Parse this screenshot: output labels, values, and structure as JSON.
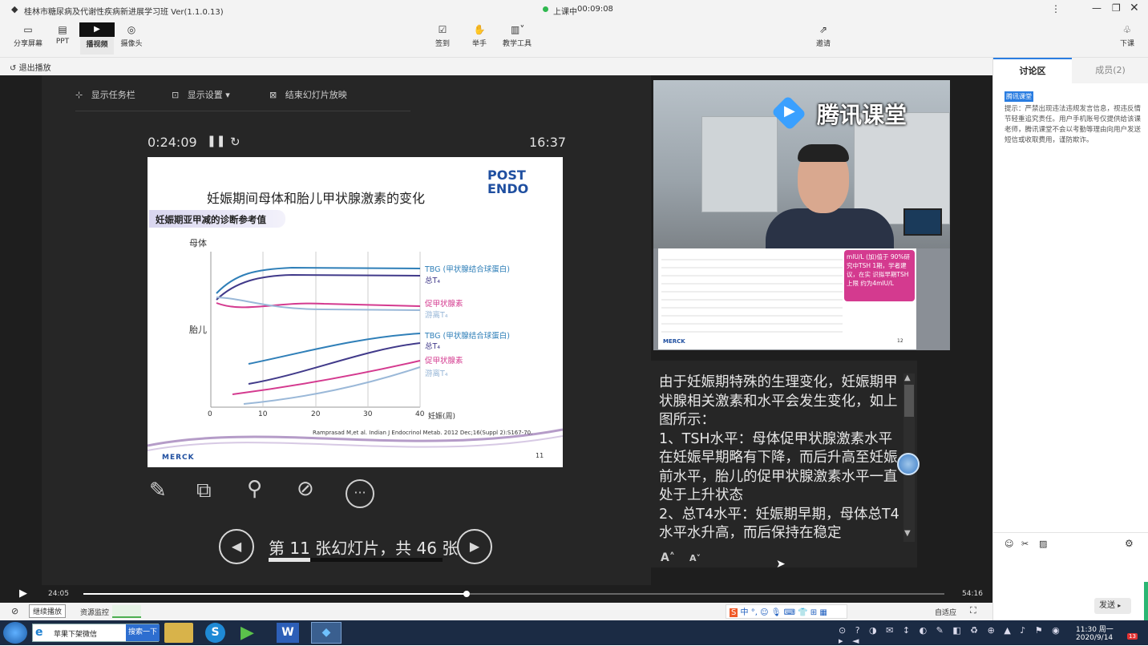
{
  "window": {
    "title": "桂林市糖尿病及代谢性疾病新进展学习班 Ver(1.1.0.13)",
    "status_label": "上课中",
    "timer": "00:09:08",
    "status_color": "#2fb84f"
  },
  "toolbar": {
    "left": [
      {
        "icon": "screen-share-icon",
        "label": "分享屏幕"
      },
      {
        "icon": "ppt-icon",
        "label": "PPT"
      },
      {
        "icon": "video-play-icon",
        "label": "播视频"
      },
      {
        "icon": "camera-icon",
        "label": "摄像头"
      }
    ],
    "center": [
      {
        "icon": "checkin-icon",
        "label": "签到"
      },
      {
        "icon": "raise-hand-icon",
        "label": "举手"
      },
      {
        "icon": "teaching-tools-icon",
        "label": "教学工具"
      }
    ],
    "invite_label": "邀请",
    "leave_label": "下课"
  },
  "subbar": {
    "exit_label": "退出播放"
  },
  "slideshow": {
    "controls": [
      "显示任务栏",
      "显示设置 ▾",
      "结束幻灯片放映"
    ],
    "elapsed": "0:24:09",
    "clock": "16:37",
    "nav_label": "第 11 张幻灯片，共 46 张",
    "nav_progress": 0.24
  },
  "slide": {
    "title": "妊娠期间母体和胎儿甲状腺激素的变化",
    "subtitle": "妊娠期亚甲减的诊断参考值",
    "logo_text": "POST\nENDO",
    "maternal_label": "母体",
    "fetal_label": "胎儿",
    "legend_maternal": [
      "TBG (甲状腺结合球蛋白)",
      "总T₄",
      "促甲状腺素",
      "游离T₄"
    ],
    "legend_fetal": [
      "TBG (甲状腺结合球蛋白)",
      "总T₄",
      "促甲状腺素",
      "游离T₄"
    ],
    "axis_label": "妊娠(周)",
    "ticks": [
      "0",
      "10",
      "20",
      "30",
      "40"
    ],
    "citation": "Ramprasad M,et al. Indian J Endocrinol Metab. 2012 Dec;16(Suppl 2):S167-70.",
    "footer_logo": "MERCK",
    "page_no": "11"
  },
  "camera": {
    "brand": "腾讯课堂",
    "overlay_text": "mIU/L (加)值于 90%研究中TSH 1期，学者建议，在实 识拟早期TSH上限 约为4mIU/L",
    "slide_footer": "MERCK",
    "slide_page": "12"
  },
  "notes": {
    "text": "由于妊娠期特殊的生理变化，妊娠期甲状腺相关激素和水平会发生变化，如上图所示：\n1、TSH水平：母体促甲状腺激素水平在妊娠早期略有下降，而后升高至妊娠前水平，胎儿的促甲状腺激素水平一直处于上升状态\n2、总T4水平：妊娠期早期，母体总T4水平水升高，而后保持在稳定",
    "font_up": "A˄",
    "font_down": "A˅"
  },
  "playback": {
    "current": "24:05",
    "total": "54:16",
    "progress": 0.445
  },
  "bottombar": {
    "continue_label": "继续播放",
    "monitor_label": "资源监控",
    "fit_label": "自适应"
  },
  "sidebar": {
    "tabs": [
      "讨论区",
      "成员(2)"
    ],
    "badge": "腾讯课堂",
    "notice": "提示：严禁出现违法违规发言信息，视违反情节轻重追究责任。用户手机账号仅提供给该课老师，腾讯课堂不会以考勤等理由向用户发送短信或收取费用，谨防欺诈。",
    "send_label": "发送",
    "send_arrow": "▸"
  },
  "taskbar": {
    "tab_label": "苹果下架微信",
    "search_label": "搜索一下",
    "ime_label": "中",
    "clock_time": "11:30 周一",
    "clock_date": "2020/9/14",
    "badge": "13"
  }
}
